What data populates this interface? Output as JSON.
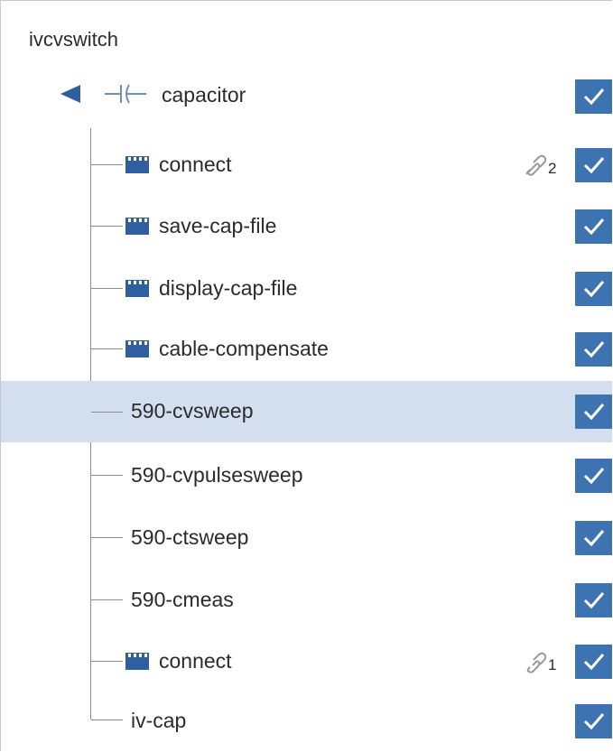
{
  "tree": {
    "root_label": "ivcvswitch",
    "group": {
      "label": "capacitor",
      "checked": true,
      "icon": "capacitor-icon",
      "collapse_icon": "collapse-arrow-icon"
    },
    "items": [
      {
        "label": "connect",
        "icon": "sequence-icon",
        "link_count": "2",
        "checked": true,
        "selected": false
      },
      {
        "label": "save-cap-file",
        "icon": "sequence-icon",
        "checked": true,
        "selected": false
      },
      {
        "label": "display-cap-file",
        "icon": "sequence-icon",
        "checked": true,
        "selected": false
      },
      {
        "label": "cable-compensate",
        "icon": "sequence-icon",
        "checked": true,
        "selected": false
      },
      {
        "label": "590-cvsweep",
        "checked": true,
        "selected": true
      },
      {
        "label": "590-cvpulsesweep",
        "checked": true,
        "selected": false
      },
      {
        "label": "590-ctsweep",
        "checked": true,
        "selected": false
      },
      {
        "label": "590-cmeas",
        "checked": true,
        "selected": false
      },
      {
        "label": "connect",
        "icon": "sequence-icon",
        "link_count": "1",
        "checked": true,
        "selected": false
      },
      {
        "label": "iv-cap",
        "checked": true,
        "selected": false
      }
    ]
  },
  "colors": {
    "checkbox": "#3d73b1",
    "selection": "#d3dfee",
    "icon_blue": "#2f5f9e",
    "tree_line": "#8c8c8c"
  }
}
